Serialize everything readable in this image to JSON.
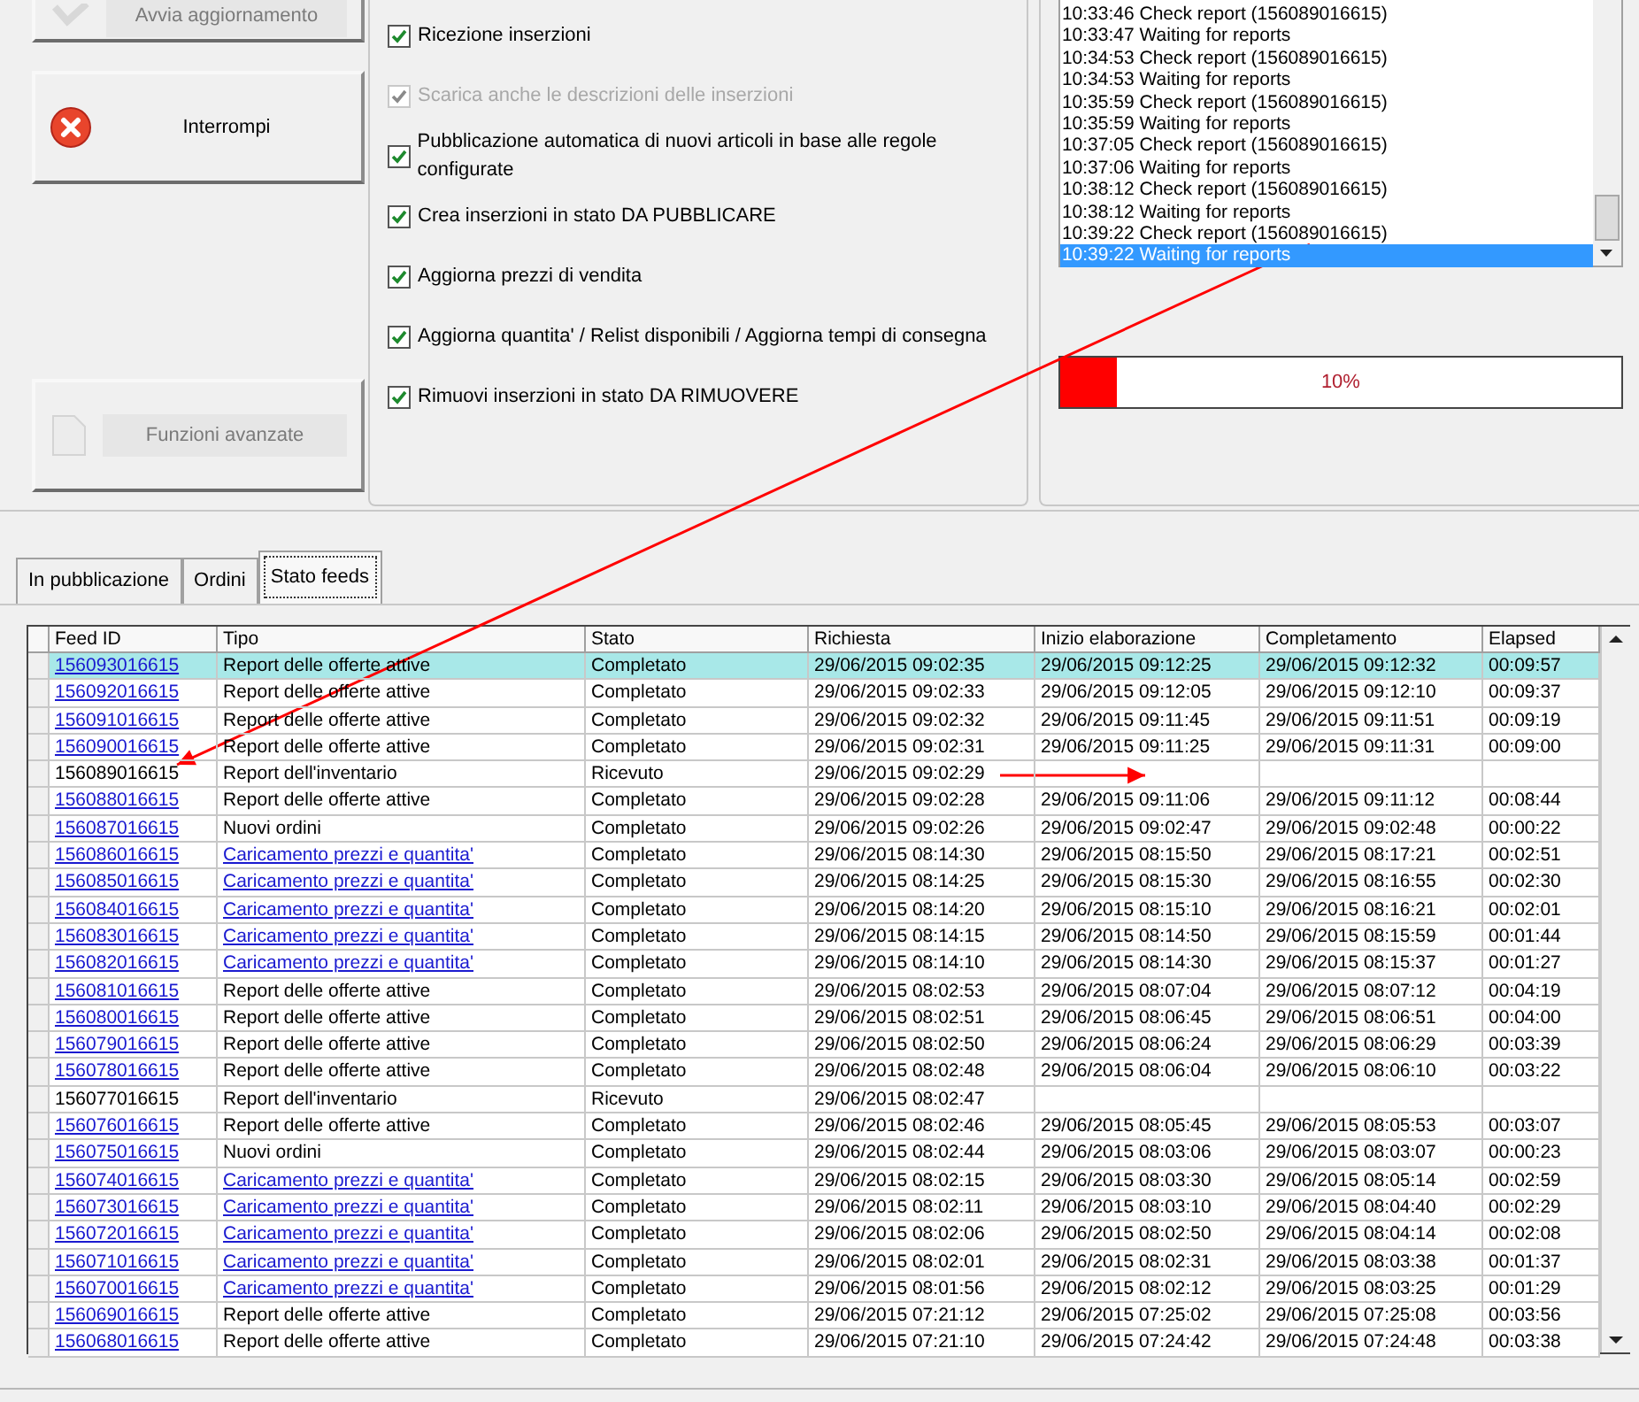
{
  "actions": [
    {
      "label": "Avvia aggiornamento",
      "disabled": true
    },
    {
      "label": "Interrompi",
      "disabled": false
    },
    {
      "label": "Funzioni avanzate",
      "disabled": true
    }
  ],
  "options": [
    {
      "label": "Ricezione inserzioni",
      "checked": true,
      "disabled": false
    },
    {
      "label": "Scarica anche le descrizioni delle inserzioni",
      "checked": true,
      "disabled": true
    },
    {
      "label": "Pubblicazione automatica di nuovi articoli in base alle regole configurate",
      "checked": true,
      "disabled": false
    },
    {
      "label": "Crea inserzioni in stato DA PUBBLICARE",
      "checked": true,
      "disabled": false
    },
    {
      "label": "Aggiorna prezzi di vendita",
      "checked": true,
      "disabled": false
    },
    {
      "label": "Aggiorna quantita' / Relist disponibili / Aggiorna tempi di consegna",
      "checked": true,
      "disabled": false
    },
    {
      "label": "Rimuovi inserzioni in stato DA RIMUOVERE",
      "checked": true,
      "disabled": false
    }
  ],
  "log": [
    {
      "time": "10:33:46",
      "message": "Check report (156089016615)",
      "selected": false
    },
    {
      "time": "10:33:47",
      "message": "Waiting for reports",
      "selected": false
    },
    {
      "time": "10:34:53",
      "message": "Check report (156089016615)",
      "selected": false
    },
    {
      "time": "10:34:53",
      "message": "Waiting for reports",
      "selected": false
    },
    {
      "time": "10:35:59",
      "message": "Check report (156089016615)",
      "selected": false
    },
    {
      "time": "10:35:59",
      "message": "Waiting for reports",
      "selected": false
    },
    {
      "time": "10:37:05",
      "message": "Check report (156089016615)",
      "selected": false
    },
    {
      "time": "10:37:06",
      "message": "Waiting for reports",
      "selected": false
    },
    {
      "time": "10:38:12",
      "message": "Check report (156089016615)",
      "selected": false
    },
    {
      "time": "10:38:12",
      "message": "Waiting for reports",
      "selected": false
    },
    {
      "time": "10:39:22",
      "message": "Check report (156089016615)",
      "selected": false
    },
    {
      "time": "10:39:22",
      "message": "Waiting for reports",
      "selected": true
    }
  ],
  "progress": {
    "level": 0.1,
    "reading": "10%"
  },
  "tabs": [
    {
      "label": "In pubblicazione",
      "selected": false
    },
    {
      "label": "Ordini",
      "selected": false
    },
    {
      "label": "Stato feeds",
      "selected": true
    }
  ],
  "table": {
    "columns": [
      "Feed ID",
      "Tipo",
      "Stato",
      "Richiesta",
      "Inizio elaborazione",
      "Completamento",
      "Elapsed"
    ],
    "rows": [
      {
        "id": "156093016615",
        "id_link": true,
        "tipo": "Report delle offerte attive",
        "tipo_link": false,
        "stato": "Completato",
        "richiesta": "29/06/2015 09:02:35",
        "inizio": "29/06/2015 09:12:25",
        "completamento": "29/06/2015 09:12:32",
        "elapsed": "00:09:57",
        "selected": true
      },
      {
        "id": "156092016615",
        "id_link": true,
        "tipo": "Report delle offerte attive",
        "tipo_link": false,
        "stato": "Completato",
        "richiesta": "29/06/2015 09:02:33",
        "inizio": "29/06/2015 09:12:05",
        "completamento": "29/06/2015 09:12:10",
        "elapsed": "00:09:37",
        "selected": false
      },
      {
        "id": "156091016615",
        "id_link": true,
        "tipo": "Report delle offerte attive",
        "tipo_link": false,
        "stato": "Completato",
        "richiesta": "29/06/2015 09:02:32",
        "inizio": "29/06/2015 09:11:45",
        "completamento": "29/06/2015 09:11:51",
        "elapsed": "00:09:19",
        "selected": false
      },
      {
        "id": "156090016615",
        "id_link": true,
        "tipo": "Report delle offerte attive",
        "tipo_link": false,
        "stato": "Completato",
        "richiesta": "29/06/2015 09:02:31",
        "inizio": "29/06/2015 09:11:25",
        "completamento": "29/06/2015 09:11:31",
        "elapsed": "00:09:00",
        "selected": false
      },
      {
        "id": "156089016615",
        "id_link": false,
        "tipo": "Report dell'inventario",
        "tipo_link": false,
        "stato": "Ricevuto",
        "richiesta": "29/06/2015 09:02:29",
        "selected": false
      },
      {
        "id": "156088016615",
        "id_link": true,
        "tipo": "Report delle offerte attive",
        "tipo_link": false,
        "stato": "Completato",
        "richiesta": "29/06/2015 09:02:28",
        "inizio": "29/06/2015 09:11:06",
        "completamento": "29/06/2015 09:11:12",
        "elapsed": "00:08:44",
        "selected": false
      },
      {
        "id": "156087016615",
        "id_link": true,
        "tipo": "Nuovi ordini",
        "tipo_link": false,
        "stato": "Completato",
        "richiesta": "29/06/2015 09:02:26",
        "inizio": "29/06/2015 09:02:47",
        "completamento": "29/06/2015 09:02:48",
        "elapsed": "00:00:22",
        "selected": false
      },
      {
        "id": "156086016615",
        "id_link": true,
        "tipo": "Caricamento prezzi e quantita'",
        "tipo_link": true,
        "stato": "Completato",
        "richiesta": "29/06/2015 08:14:30",
        "inizio": "29/06/2015 08:15:50",
        "completamento": "29/06/2015 08:17:21",
        "elapsed": "00:02:51",
        "selected": false
      },
      {
        "id": "156085016615",
        "id_link": true,
        "tipo": "Caricamento prezzi e quantita'",
        "tipo_link": true,
        "stato": "Completato",
        "richiesta": "29/06/2015 08:14:25",
        "inizio": "29/06/2015 08:15:30",
        "completamento": "29/06/2015 08:16:55",
        "elapsed": "00:02:30",
        "selected": false
      },
      {
        "id": "156084016615",
        "id_link": true,
        "tipo": "Caricamento prezzi e quantita'",
        "tipo_link": true,
        "stato": "Completato",
        "richiesta": "29/06/2015 08:14:20",
        "inizio": "29/06/2015 08:15:10",
        "completamento": "29/06/2015 08:16:21",
        "elapsed": "00:02:01",
        "selected": false
      },
      {
        "id": "156083016615",
        "id_link": true,
        "tipo": "Caricamento prezzi e quantita'",
        "tipo_link": true,
        "stato": "Completato",
        "richiesta": "29/06/2015 08:14:15",
        "inizio": "29/06/2015 08:14:50",
        "completamento": "29/06/2015 08:15:59",
        "elapsed": "00:01:44",
        "selected": false
      },
      {
        "id": "156082016615",
        "id_link": true,
        "tipo": "Caricamento prezzi e quantita'",
        "tipo_link": true,
        "stato": "Completato",
        "richiesta": "29/06/2015 08:14:10",
        "inizio": "29/06/2015 08:14:30",
        "completamento": "29/06/2015 08:15:37",
        "elapsed": "00:01:27",
        "selected": false
      },
      {
        "id": "156081016615",
        "id_link": true,
        "tipo": "Report delle offerte attive",
        "tipo_link": false,
        "stato": "Completato",
        "richiesta": "29/06/2015 08:02:53",
        "inizio": "29/06/2015 08:07:04",
        "completamento": "29/06/2015 08:07:12",
        "elapsed": "00:04:19",
        "selected": false
      },
      {
        "id": "156080016615",
        "id_link": true,
        "tipo": "Report delle offerte attive",
        "tipo_link": false,
        "stato": "Completato",
        "richiesta": "29/06/2015 08:02:51",
        "inizio": "29/06/2015 08:06:45",
        "completamento": "29/06/2015 08:06:51",
        "elapsed": "00:04:00",
        "selected": false
      },
      {
        "id": "156079016615",
        "id_link": true,
        "tipo": "Report delle offerte attive",
        "tipo_link": false,
        "stato": "Completato",
        "richiesta": "29/06/2015 08:02:50",
        "inizio": "29/06/2015 08:06:24",
        "completamento": "29/06/2015 08:06:29",
        "elapsed": "00:03:39",
        "selected": false
      },
      {
        "id": "156078016615",
        "id_link": true,
        "tipo": "Report delle offerte attive",
        "tipo_link": false,
        "stato": "Completato",
        "richiesta": "29/06/2015 08:02:48",
        "inizio": "29/06/2015 08:06:04",
        "completamento": "29/06/2015 08:06:10",
        "elapsed": "00:03:22",
        "selected": false
      },
      {
        "id": "156077016615",
        "id_link": false,
        "tipo": "Report dell'inventario",
        "tipo_link": false,
        "stato": "Ricevuto",
        "richiesta": "29/06/2015 08:02:47",
        "selected": false
      },
      {
        "id": "156076016615",
        "id_link": true,
        "tipo": "Report delle offerte attive",
        "tipo_link": false,
        "stato": "Completato",
        "richiesta": "29/06/2015 08:02:46",
        "inizio": "29/06/2015 08:05:45",
        "completamento": "29/06/2015 08:05:53",
        "elapsed": "00:03:07",
        "selected": false
      },
      {
        "id": "156075016615",
        "id_link": true,
        "tipo": "Nuovi ordini",
        "tipo_link": false,
        "stato": "Completato",
        "richiesta": "29/06/2015 08:02:44",
        "inizio": "29/06/2015 08:03:06",
        "completamento": "29/06/2015 08:03:07",
        "elapsed": "00:00:23",
        "selected": false
      },
      {
        "id": "156074016615",
        "id_link": true,
        "tipo": "Caricamento prezzi e quantita'",
        "tipo_link": true,
        "stato": "Completato",
        "richiesta": "29/06/2015 08:02:15",
        "inizio": "29/06/2015 08:03:30",
        "completamento": "29/06/2015 08:05:14",
        "elapsed": "00:02:59",
        "selected": false
      },
      {
        "id": "156073016615",
        "id_link": true,
        "tipo": "Caricamento prezzi e quantita'",
        "tipo_link": true,
        "stato": "Completato",
        "richiesta": "29/06/2015 08:02:11",
        "inizio": "29/06/2015 08:03:10",
        "completamento": "29/06/2015 08:04:40",
        "elapsed": "00:02:29",
        "selected": false
      },
      {
        "id": "156072016615",
        "id_link": true,
        "tipo": "Caricamento prezzi e quantita'",
        "tipo_link": true,
        "stato": "Completato",
        "richiesta": "29/06/2015 08:02:06",
        "inizio": "29/06/2015 08:02:50",
        "completamento": "29/06/2015 08:04:14",
        "elapsed": "00:02:08",
        "selected": false
      },
      {
        "id": "156071016615",
        "id_link": true,
        "tipo": "Caricamento prezzi e quantita'",
        "tipo_link": true,
        "stato": "Completato",
        "richiesta": "29/06/2015 08:02:01",
        "inizio": "29/06/2015 08:02:31",
        "completamento": "29/06/2015 08:03:38",
        "elapsed": "00:01:37",
        "selected": false
      },
      {
        "id": "156070016615",
        "id_link": true,
        "tipo": "Caricamento prezzi e quantita'",
        "tipo_link": true,
        "stato": "Completato",
        "richiesta": "29/06/2015 08:01:56",
        "inizio": "29/06/2015 08:02:12",
        "completamento": "29/06/2015 08:03:25",
        "elapsed": "00:01:29",
        "selected": false
      },
      {
        "id": "156069016615",
        "id_link": true,
        "tipo": "Report delle offerte attive",
        "tipo_link": false,
        "stato": "Completato",
        "richiesta": "29/06/2015 07:21:12",
        "inizio": "29/06/2015 07:25:02",
        "completamento": "29/06/2015 07:25:08",
        "elapsed": "00:03:56",
        "selected": false
      },
      {
        "id": "156068016615",
        "id_link": true,
        "tipo": "Report delle offerte attive",
        "tipo_link": false,
        "stato": "Completato",
        "richiesta": "29/06/2015 07:21:10",
        "inizio": "29/06/2015 07:24:42",
        "completamento": "29/06/2015 07:24:48",
        "elapsed": "00:03:38",
        "selected": false
      }
    ]
  }
}
